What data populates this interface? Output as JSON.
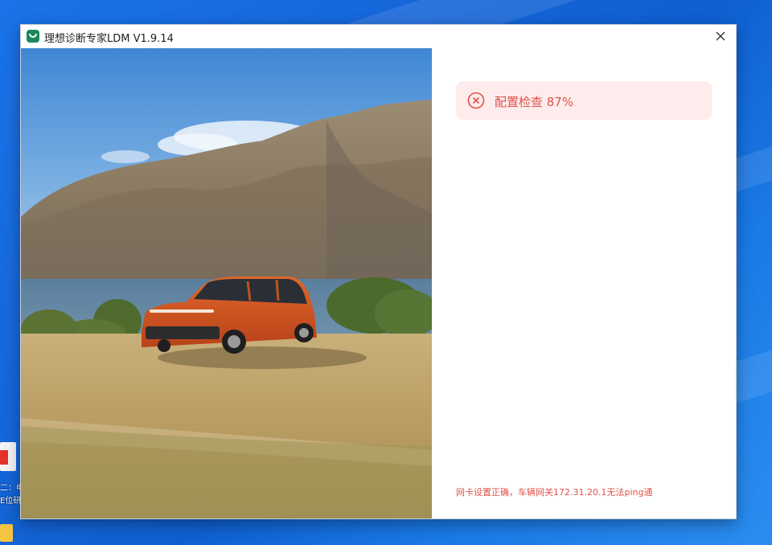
{
  "window": {
    "title": "理想诊断专家LDM V1.9.14",
    "app_icon": "li-auto-logo-icon",
    "close_icon": "close-icon"
  },
  "status": {
    "icon": "error-circle-x-icon",
    "text": "配置检查 87%",
    "progress_percent": 87
  },
  "message": {
    "text": "网卡设置正确，车辆网关172.31.20.1无法ping通"
  },
  "desktop": {
    "label1": "二：电",
    "label2": "E位研"
  },
  "colors": {
    "error_red": "#e2524c",
    "status_bg": "#fdeceb",
    "desktop_blue": "#1565d8",
    "car_orange": "#d9541c"
  }
}
